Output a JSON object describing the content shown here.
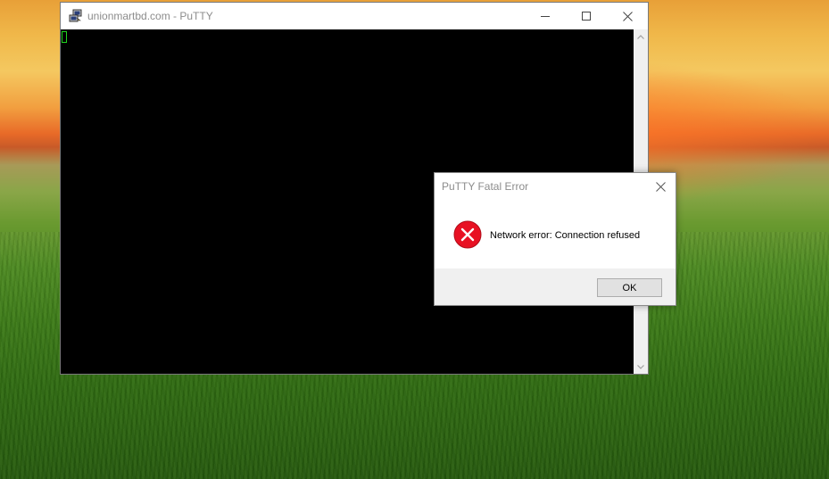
{
  "putty_window": {
    "title": "unionmartbd.com - PuTTY",
    "app_icon": "putty-icon",
    "controls": {
      "minimize_icon": "minimize-icon",
      "maximize_icon": "maximize-icon",
      "close_icon": "close-icon"
    },
    "terminal": {
      "background": "#000000",
      "cursor_color": "#1fd41f"
    }
  },
  "error_dialog": {
    "title": "PuTTY Fatal Error",
    "icon": "error-icon",
    "icon_color": "#e81123",
    "message": "Network error: Connection refused",
    "ok_label": "OK"
  }
}
